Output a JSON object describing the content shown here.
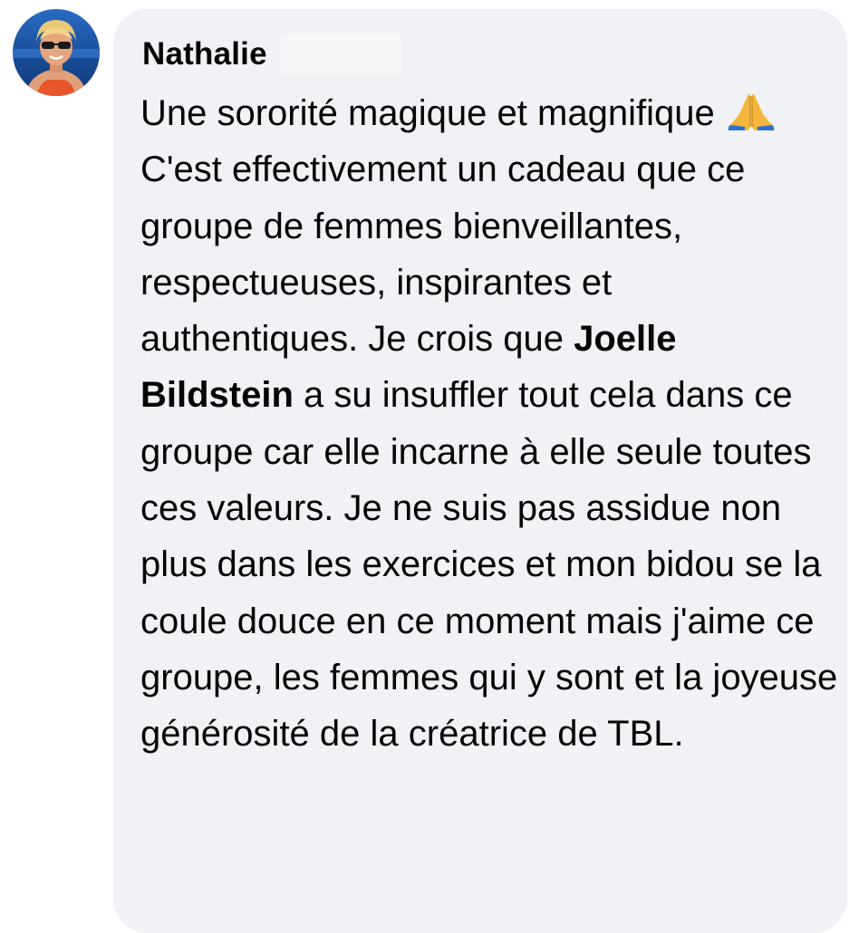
{
  "comment": {
    "author": {
      "name": "Nathalie",
      "avatar_icon": "profile-photo-avatar"
    },
    "text": {
      "before_emoji": "Une sororité magique et magnifique ",
      "emoji_icon": "folded-hands-emoji",
      "after_emoji": " C'est effectivement un cadeau que ce groupe de femmes bienveillantes, respectueuses, inspirantes et authentiques. Je crois que ",
      "mention": "Joelle Bildstein",
      "after_mention": " a su insuffler tout cela dans ce groupe car elle incarne à elle seule toutes ces valeurs. Je ne suis pas assidue non plus dans les exercices et mon bidou se la coule douce en ce moment mais j'aime ce groupe, les femmes qui y sont et la joyeuse générosité de la créatrice de TBL."
    }
  },
  "colors": {
    "bubble_background": "#f0f2f5",
    "text": "#050505",
    "avatar_background": "#1f5fb0",
    "skin": "#e0a07a",
    "swimsuit": "#e8552a"
  }
}
